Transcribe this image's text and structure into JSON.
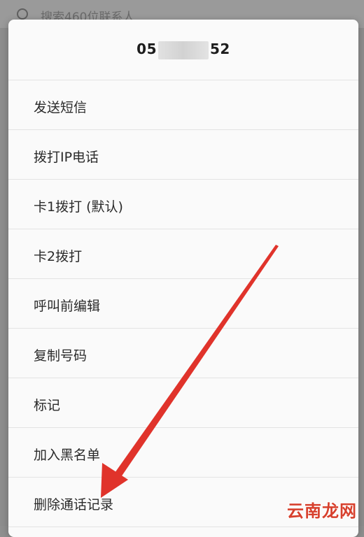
{
  "backdrop": {
    "search_hint": "搜索460位联系人"
  },
  "dialog": {
    "title_start": "05",
    "title_end": "52",
    "items": [
      {
        "label": "发送短信"
      },
      {
        "label": "拨打IP电话"
      },
      {
        "label": "卡1拨打 (默认)"
      },
      {
        "label": "卡2拨打"
      },
      {
        "label": "呼叫前编辑"
      },
      {
        "label": "复制号码"
      },
      {
        "label": "标记"
      },
      {
        "label": "加入黑名单"
      },
      {
        "label": "删除通话记录"
      }
    ]
  },
  "annotation": {
    "arrow_color": "#e0332b"
  },
  "watermark": "云南龙网"
}
